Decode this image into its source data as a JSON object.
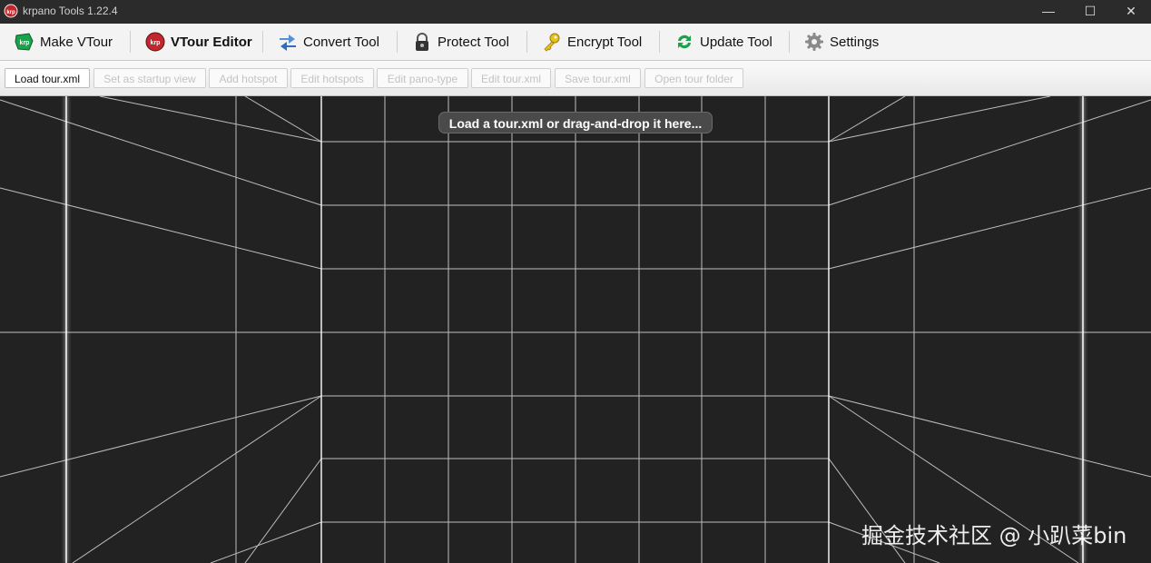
{
  "window": {
    "title": "krpano Tools 1.22.4",
    "minimize": "—",
    "maximize": "☐",
    "close": "✕"
  },
  "toolbar": {
    "make_vtour": "Make VTour",
    "vtour_editor": "VTour Editor",
    "convert_tool": "Convert Tool",
    "protect_tool": "Protect Tool",
    "encrypt_tool": "Encrypt Tool",
    "update_tool": "Update Tool",
    "settings": "Settings"
  },
  "editor_bar": {
    "load_tour": "Load tour.xml",
    "set_startup_view": "Set as startup view",
    "add_hotspot": "Add hotspot",
    "edit_hotspots": "Edit hotspots",
    "edit_pano_type": "Edit pano-type",
    "edit_tour_xml": "Edit tour.xml",
    "save_tour_xml": "Save tour.xml",
    "open_tour_folder": "Open tour folder"
  },
  "viewer": {
    "hint": "Load a tour.xml or drag-and-drop it here..."
  },
  "watermark": "掘金技术社区 @ 小趴菜bin",
  "icons": {
    "app": "krpano-logo-icon",
    "make_vtour": "krpano-green-icon",
    "vtour_editor": "krpano-red-icon",
    "convert": "arrows-convert-icon",
    "protect": "padlock-icon",
    "encrypt": "key-icon",
    "update": "refresh-icon",
    "settings": "gear-icon"
  },
  "colors": {
    "accent_green": "#1aa34a",
    "accent_red": "#c0282d",
    "key_yellow": "#e7c21c",
    "viewer_bg": "#222222",
    "grid_line": "#d9d9d9"
  }
}
